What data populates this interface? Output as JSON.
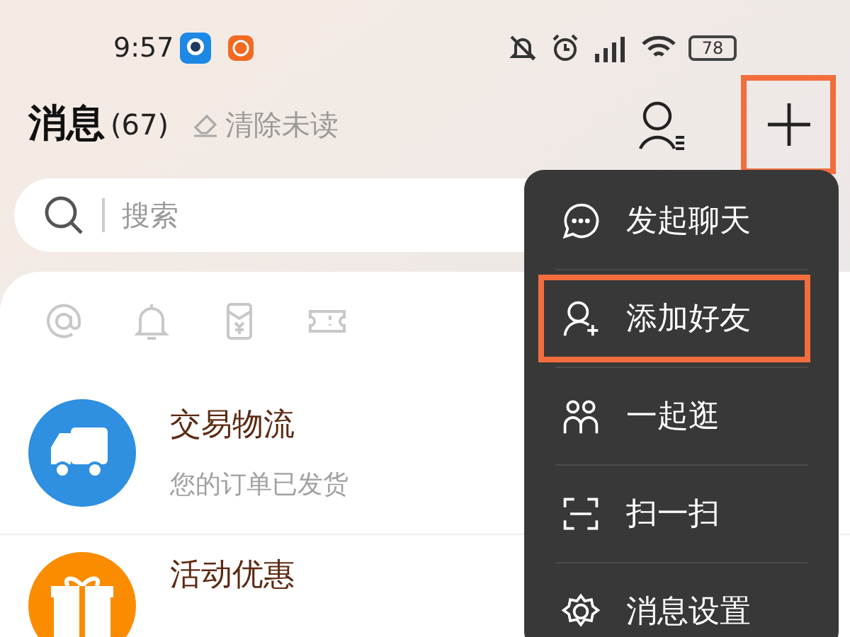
{
  "status_bar": {
    "time": "9:57",
    "battery": "78"
  },
  "header": {
    "title": "消息",
    "count": "(67)",
    "clear_label": "清除未读",
    "add_button": {
      "highlighted": true
    }
  },
  "search": {
    "placeholder": "搜索"
  },
  "shortcuts": [
    {
      "kind": "at"
    },
    {
      "kind": "bell"
    },
    {
      "kind": "redpacket"
    },
    {
      "kind": "ticket"
    }
  ],
  "conversations": [
    {
      "kind": "logistics",
      "title": "交易物流",
      "subtitle": "您的订单已发货"
    },
    {
      "kind": "promo",
      "title": "活动优惠"
    }
  ],
  "menu": [
    {
      "kind": "chat",
      "label": "发起聊天",
      "highlighted": false
    },
    {
      "kind": "add-friend",
      "label": "添加好友",
      "highlighted": true
    },
    {
      "kind": "together",
      "label": "一起逛",
      "highlighted": false
    },
    {
      "kind": "scan",
      "label": "扫一扫",
      "highlighted": false
    },
    {
      "kind": "settings",
      "label": "消息设置",
      "highlighted": false
    }
  ]
}
